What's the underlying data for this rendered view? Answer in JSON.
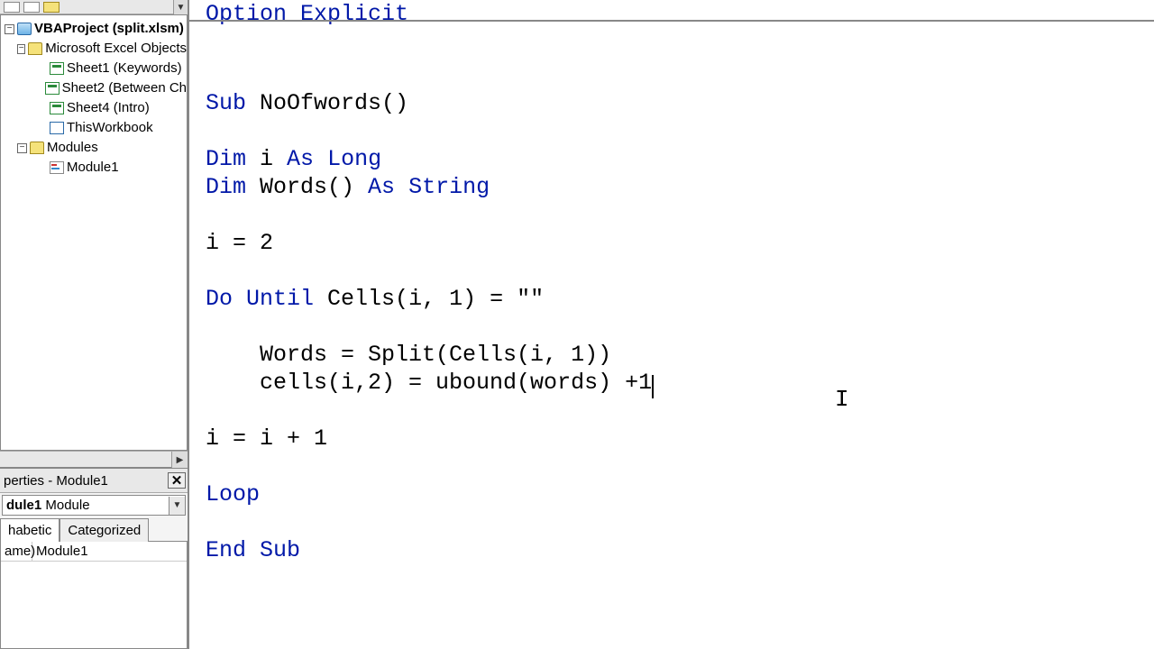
{
  "project": {
    "root": "VBAProject (split.xlsm)",
    "excel_objects_folder": "Microsoft Excel Objects",
    "sheets": [
      "Sheet1 (Keywords)",
      "Sheet2 (Between Ch",
      "Sheet4 (Intro)"
    ],
    "workbook": "ThisWorkbook",
    "modules_folder": "Modules",
    "module1": "Module1"
  },
  "properties": {
    "title": "perties - Module1",
    "dropdown_bold": "dule1",
    "dropdown_rest": " Module",
    "tab_alpha": "habetic",
    "tab_cat": "Categorized",
    "name_key": "ame)",
    "name_val": "Module1"
  },
  "code": {
    "l01a": "Option",
    "l01b": " Explicit",
    "l02": "",
    "l03": "",
    "l04a": "Sub",
    "l04b": " NoOfwords()",
    "l05": "",
    "l06a": "Dim",
    "l06b": " i ",
    "l06c": "As",
    "l06d": " ",
    "l06e": "Long",
    "l07a": "Dim",
    "l07b": " Words() ",
    "l07c": "As",
    "l07d": " ",
    "l07e": "String",
    "l08": "",
    "l09": "i = 2",
    "l10": "",
    "l11a": "Do",
    "l11b": " ",
    "l11c": "Until",
    "l11d": " Cells(i, 1) = \"\"",
    "l12": "",
    "l13": "    Words = Split(Cells(i, 1))",
    "l14": "    cells(i,2) = ubound(words) +1",
    "l15": "",
    "l16": "i = i + 1",
    "l17": "",
    "l18": "Loop",
    "l19": "",
    "l20a": "End",
    "l20b": " ",
    "l20c": "Sub"
  }
}
